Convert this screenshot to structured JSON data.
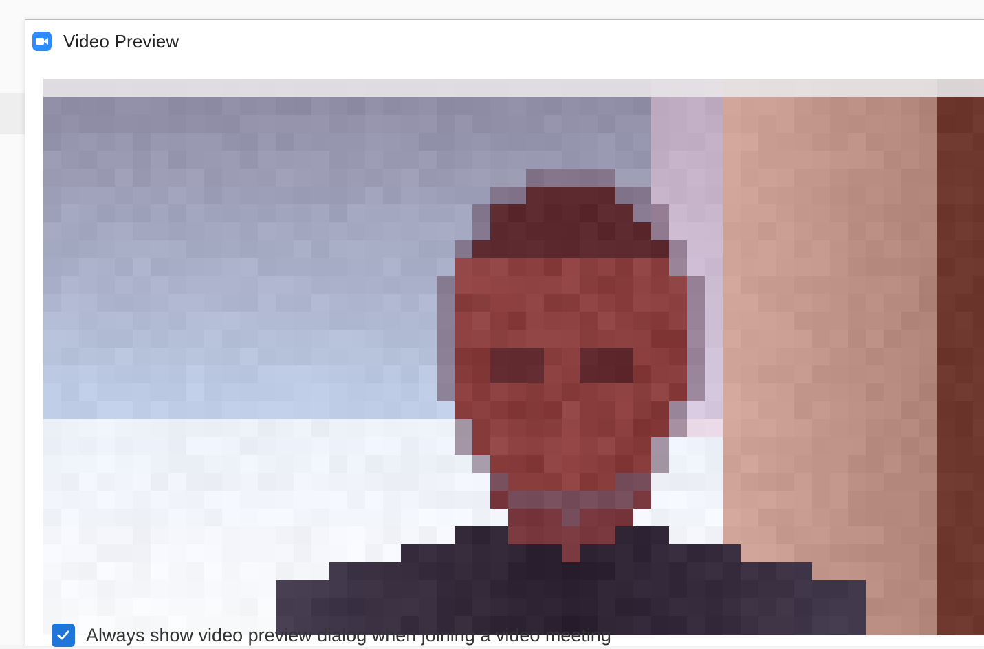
{
  "window": {
    "title": "Video Preview",
    "app_icon": "zoom-camera-icon",
    "accent_color": "#2d8cff"
  },
  "video_preview": {
    "content": "pixelated-webcam-feed"
  },
  "options": {
    "always_show_preview": {
      "label": "Always show video preview dialog when joining a video meeting",
      "checked": true,
      "color": "#1f75d8"
    }
  }
}
